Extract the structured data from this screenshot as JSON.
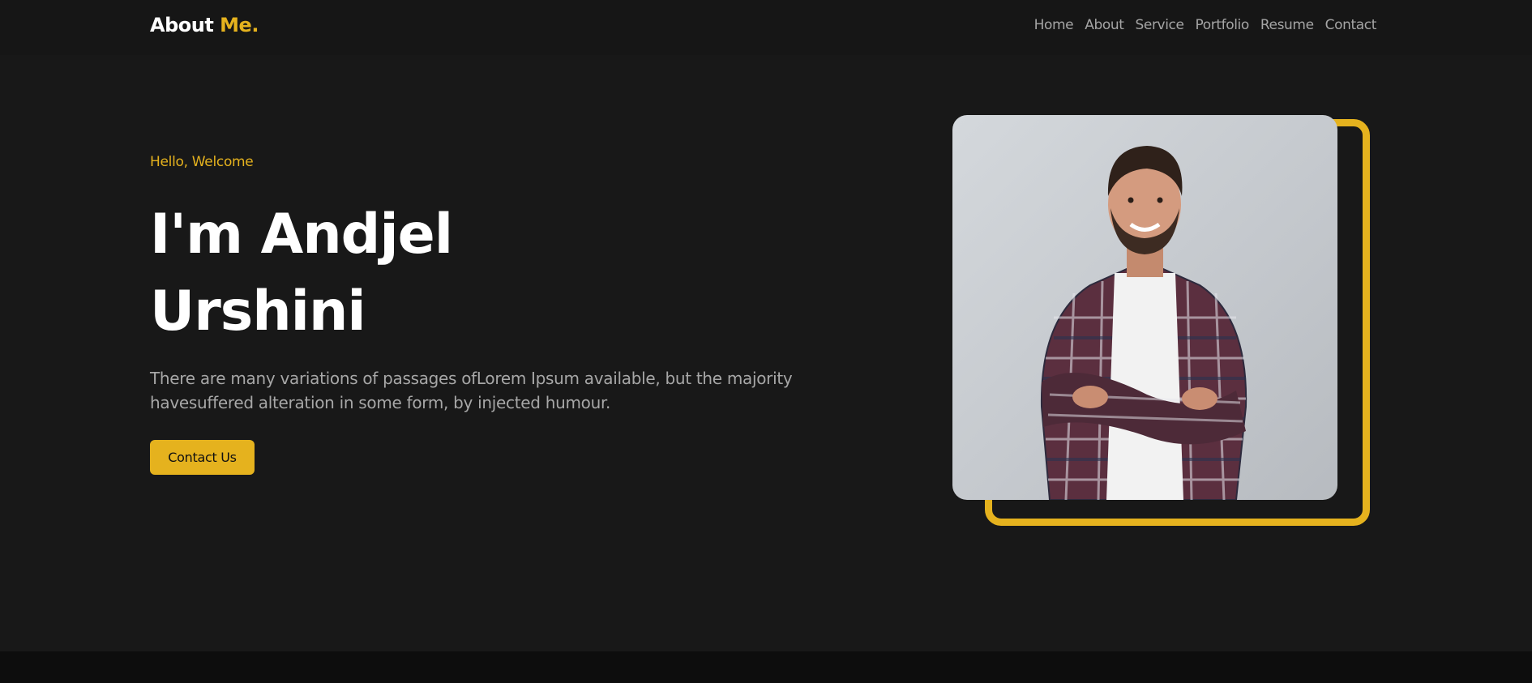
{
  "brand": {
    "text": "About",
    "accent": "Me."
  },
  "nav": {
    "items": [
      "Home",
      "About",
      "Service",
      "Portfolio",
      "Resume",
      "Contact"
    ]
  },
  "hero": {
    "eyebrow": "Hello, Welcome",
    "title_line1": "I'm Andjel",
    "title_line2": "Urshini",
    "desc_line1": "There are many variations of passages ofLorem Ipsum available, but the majority",
    "desc_line2": "havesuffered alteration in some form, by injected humour.",
    "cta_label": "Contact Us"
  },
  "colors": {
    "background": "#181818",
    "navbar": "#161616",
    "accent": "#e5b21e",
    "heading": "#ffffff",
    "muted_text": "#a7a7a7",
    "footer": "#0d0d0d"
  },
  "icons": {
    "portrait": "person-portrait-photo"
  }
}
